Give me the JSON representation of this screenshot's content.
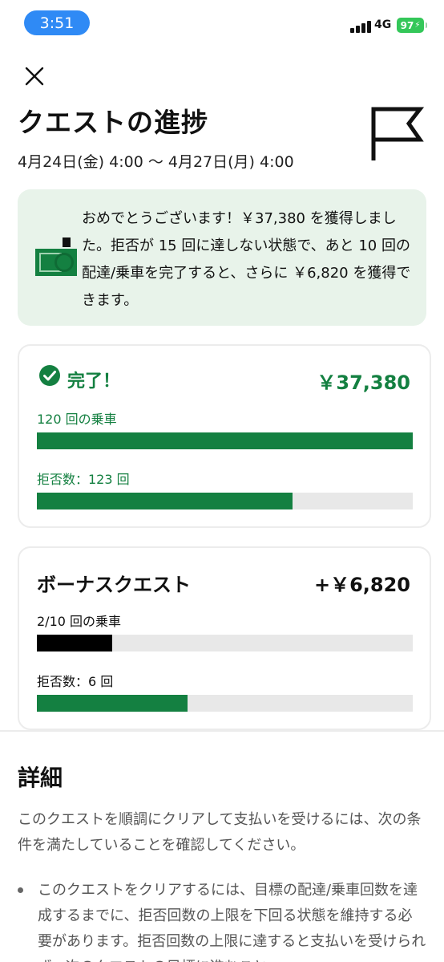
{
  "status": {
    "time": "3:51",
    "network": "4G",
    "battery": "97"
  },
  "header": {
    "title": "クエストの進捗",
    "dates": "4月24日(金) 4:00 〜 4月27日(月) 4:00"
  },
  "banner": {
    "message": "おめでとうございます！￥37,380 を獲得しました。拒否が 15 回に達しない状態で、あと 10 回の配達/乗車を完了すると、さらに ￥6,820 を獲得できます。"
  },
  "quest_main": {
    "status_label": "完了！",
    "amount": "￥37,380",
    "trips_label": "120 回の乗車",
    "trips_progress": 1.0,
    "rejects_label": "拒否数：123 回",
    "rejects_progress": 0.68
  },
  "quest_bonus": {
    "title": "ボーナスクエスト",
    "amount": "+￥6,820",
    "trips_label": "2/10 回の乗車",
    "trips_progress": 0.2,
    "rejects_label": "拒否数：6 回",
    "rejects_progress": 0.4
  },
  "details": {
    "title": "詳細",
    "intro": "このクエストを順調にクリアして支払いを受けるには、次の条件を満たしていることを確認してください。",
    "bullets": [
      "このクエストをクリアするには、目標の配達/乗車回数を達成するまでに、拒否回数の上限を下回る状態を維持する必要があります。拒否回数の上限に達すると支払いを受けられず、次のクエストの目標に進むこと"
    ]
  },
  "colors": {
    "brand_green": "#148041",
    "banner_bg": "#e8f3ea",
    "track": "#e8e8e8"
  }
}
